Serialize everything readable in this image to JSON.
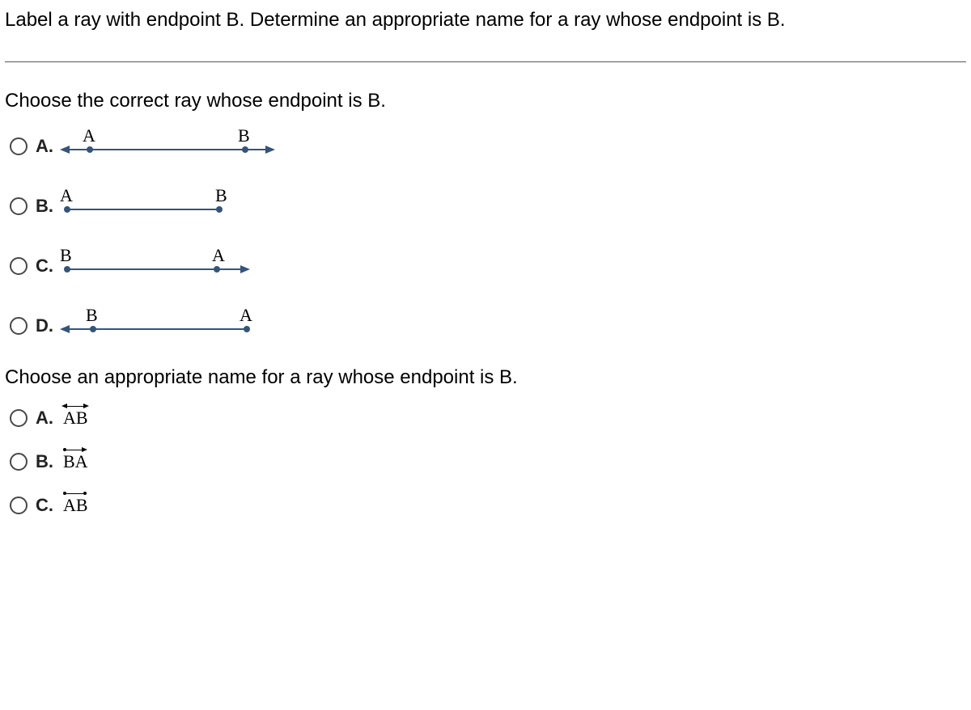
{
  "header": "Label a ray with endpoint B. Determine an appropriate name for a ray whose endpoint is B.",
  "q1": {
    "prompt": "Choose the correct ray whose endpoint is B.",
    "options": {
      "a": {
        "letter": "A.",
        "left_label": "A",
        "right_label": "B"
      },
      "b": {
        "letter": "B.",
        "left_label": "A",
        "right_label": "B"
      },
      "c": {
        "letter": "C.",
        "left_label": "B",
        "right_label": "A"
      },
      "d": {
        "letter": "D.",
        "left_label": "B",
        "right_label": "A"
      }
    }
  },
  "q2": {
    "prompt": "Choose an appropriate name for a ray whose endpoint is B.",
    "options": {
      "a": {
        "letter": "A.",
        "text": "AB"
      },
      "b": {
        "letter": "B.",
        "text": "BA"
      },
      "c": {
        "letter": "C.",
        "text": "AB"
      }
    }
  }
}
